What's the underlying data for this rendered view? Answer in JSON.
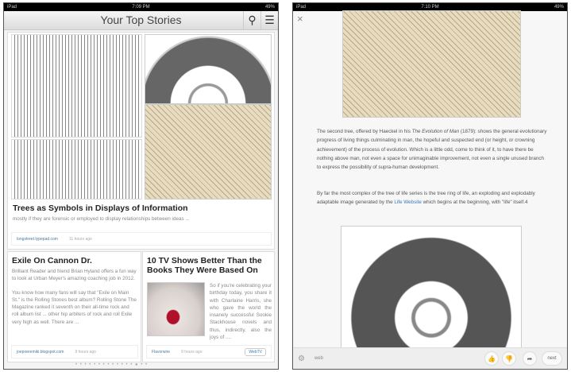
{
  "left": {
    "status": {
      "carrier": "iPad",
      "time": "7:09 PM",
      "battery": "49%"
    },
    "header": {
      "title": "Your Top Stories",
      "search_icon": "search-icon",
      "menu_icon": "menu-icon"
    },
    "featured": {
      "title": "Trees as Symbols in Displays of Information",
      "excerpt": "mostly if they are forensic or employed to display relationships between ideas ...",
      "source": "longstreet.typepad.com",
      "time": "11 hours ago"
    },
    "story1": {
      "title": "Exile On Cannon Dr.",
      "p1": "Brilliant Reader and friend Brian Hyland offers a fun way to look at Urban Meyer's amazing coaching job in 2012.",
      "p2": "You know how many fans will say that \"Exile on Main St.\" is the Rolling Stones best album? Rolling Stone The Magazine ranked it seventh on their all-time rock and roll album list ... other hip arbiters of rock and roll Exile very high as well. There are ...",
      "source": "joepoeremiki.blogspot.com",
      "time": "9 hours ago"
    },
    "story2": {
      "title": "10 TV Shows Better Than the Books They Were Based On",
      "excerpt": "So if you're celebrating your birthday today, you share it with Charlaine Harris, she who gave the world the insanely successful Sookie Stackhouse novels and thus, indirectly, also the joys of ....",
      "source": "Flavorwire",
      "time": "9 hours ago",
      "tag": "WebTV"
    },
    "dots": "• • • • • • • • • • • • • ● • •"
  },
  "right": {
    "status": {
      "carrier": "iPad",
      "time": "7:10 PM",
      "battery": "49%"
    },
    "close": "×",
    "p1_a": "The second tree, offered by Haeckel in his ",
    "p1_em": "The Evolution of Man",
    "p1_b": " (1879): shows the general evolutionary progress of living things culminating in man, the hopeful and suspected end (or height, or crowning achievement) of the process of evolution. Which is a little odd, come to think of it, to have there be nothing above man, not even a space for unimaginable improvement, not even a single unused branch to express the possibility of supra-human development.",
    "p2_a": "By far the most complex of the tree of life series is the tree ring of life, an exploding and explodably adaptable image generated by the ",
    "p2_link": "Life Website",
    "p2_b": " which begins at the beginning, with \"life\" itself.4",
    "toolbar": {
      "source": "web",
      "next": "next"
    }
  }
}
